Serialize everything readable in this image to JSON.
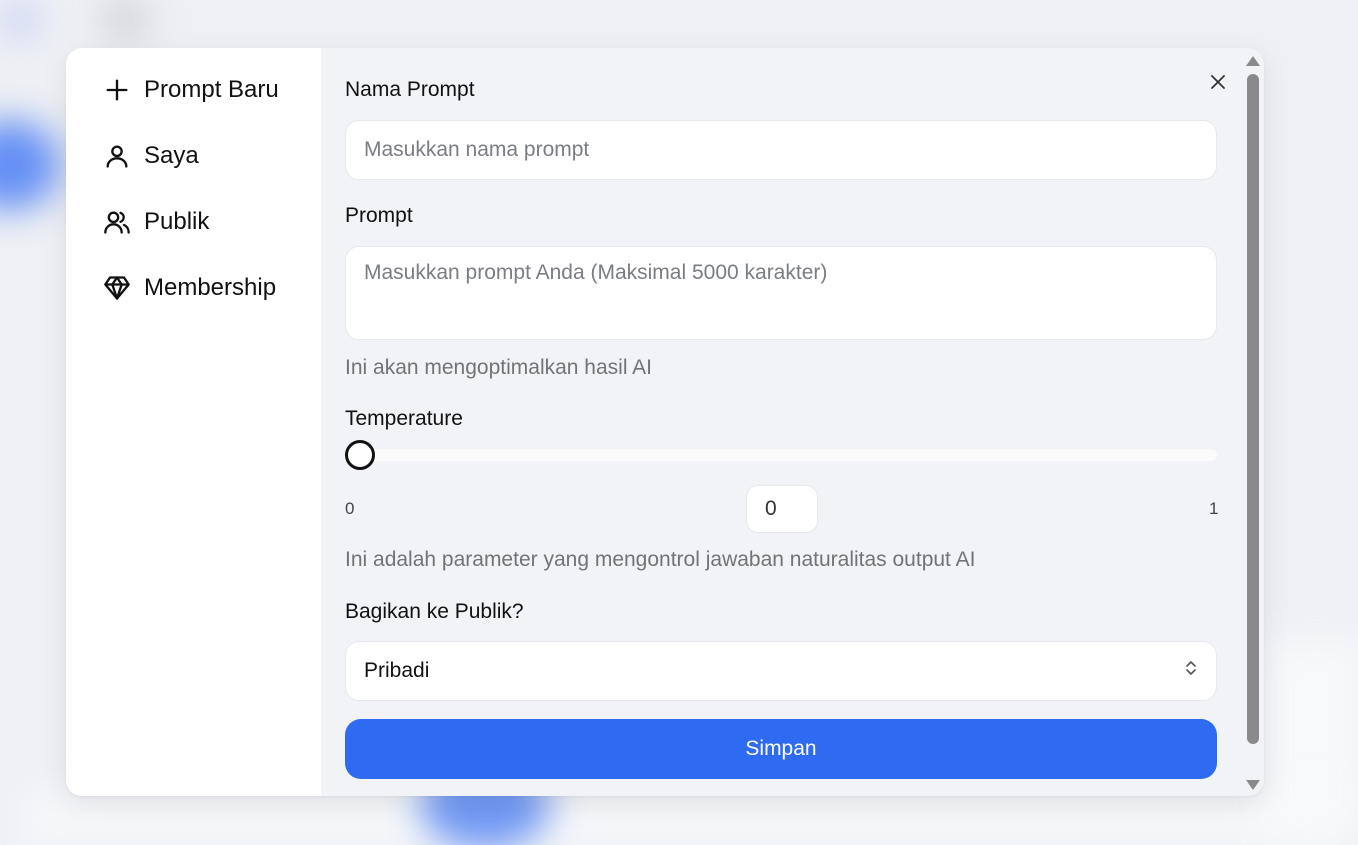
{
  "sidebar": {
    "items": [
      {
        "label": "Prompt Baru",
        "icon": "plus-icon"
      },
      {
        "label": "Saya",
        "icon": "user-icon"
      },
      {
        "label": "Publik",
        "icon": "users-icon"
      },
      {
        "label": "Membership",
        "icon": "diamond-icon"
      }
    ]
  },
  "form": {
    "name_label": "Nama Prompt",
    "name_placeholder": "Masukkan nama prompt",
    "name_value": "",
    "prompt_label": "Prompt",
    "prompt_placeholder": "Masukkan prompt Anda (Maksimal 5000 karakter)",
    "prompt_value": "",
    "prompt_hint": "Ini akan mengoptimalkan hasil AI",
    "temperature_label": "Temperature",
    "temperature_min": "0",
    "temperature_max": "1",
    "temperature_value": "0",
    "temperature_fraction": 0,
    "temperature_hint": "Ini adalah parameter yang mengontrol jawaban naturalitas output AI",
    "share_label": "Bagikan ke Publik?",
    "share_selected": "Pribadi",
    "save_label": "Simpan"
  },
  "colors": {
    "primary": "#2f6bf0",
    "background": "#f2f3f7",
    "sidebar": "#ffffff"
  }
}
